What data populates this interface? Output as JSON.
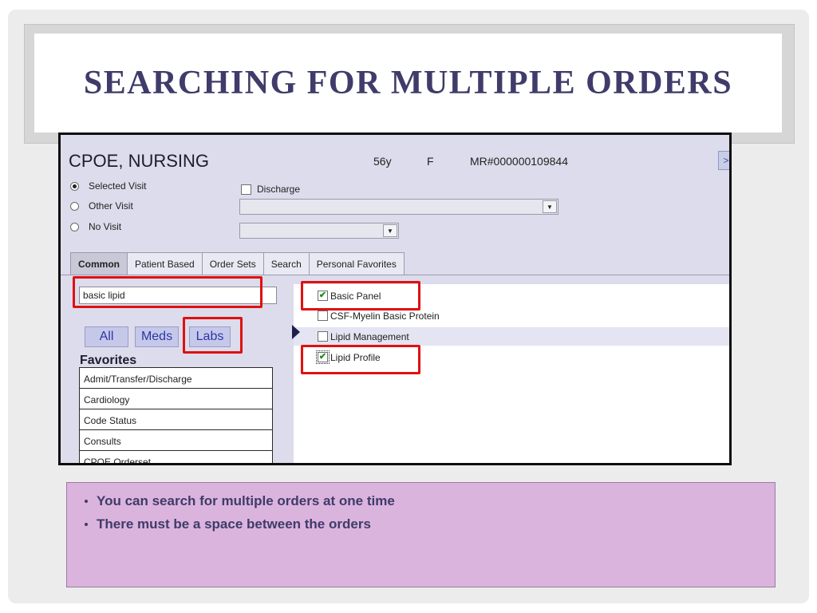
{
  "slide": {
    "title": "SEARCHING FOR MULTIPLE ORDERS",
    "bullets": [
      "You can search for multiple orders at one time",
      "There must be a space between the orders"
    ]
  },
  "patient": {
    "name": "CPOE, NURSING",
    "age": "56y",
    "sex": "F",
    "mrn": "MR#000000109844"
  },
  "visit_options": [
    {
      "label": "Selected Visit",
      "selected": true
    },
    {
      "label": "Other Visit",
      "selected": false
    },
    {
      "label": "No Visit",
      "selected": false
    }
  ],
  "discharge_label": "Discharge",
  "corner_button": ">",
  "tabs": [
    "Common",
    "Patient Based",
    "Order Sets",
    "Search",
    "Personal Favorites"
  ],
  "active_tab": "Common",
  "search": {
    "value": "basic lipid"
  },
  "filters": [
    "All",
    "Meds",
    "Labs"
  ],
  "favorites": {
    "heading": "Favorites",
    "items": [
      "Admit/Transfer/Discharge",
      "Cardiology",
      "Code Status",
      "Consults",
      "CPOE Orderset"
    ]
  },
  "results": [
    {
      "label": "Basic Panel",
      "checked": true
    },
    {
      "label": "CSF-Myelin Basic Protein",
      "checked": false
    },
    {
      "label": "Lipid Management",
      "checked": false
    },
    {
      "label": "Lipid Profile",
      "checked": true
    }
  ],
  "colors": {
    "title": "#3f3b6a",
    "highlight_box": "#e01010",
    "bullet_box_bg": "#dbb4dd",
    "filter_button_text": "#2a37a6",
    "checkmark": "#1e8a1e"
  }
}
